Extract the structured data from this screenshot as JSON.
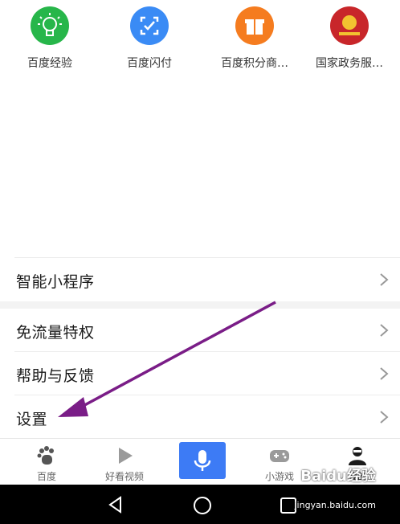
{
  "apps": [
    {
      "label": "百度经验",
      "color": "#27b64a",
      "icon": "lightbulb-icon"
    },
    {
      "label": "百度闪付",
      "color": "#3a8bf5",
      "icon": "scan-icon"
    },
    {
      "label": "百度积分商…",
      "color": "#f57c1f",
      "icon": "gift-icon"
    },
    {
      "label": "国家政务服…",
      "color": "#c8262a",
      "icon": "emblem-icon"
    }
  ],
  "menu": {
    "mini_programs": "智能小程序",
    "free_data": "免流量特权",
    "help_feedback": "帮助与反馈",
    "settings": "设置"
  },
  "tabs": {
    "baidu": "百度",
    "haokan": "好看视频",
    "mini_games": "小游戏",
    "mine": "我的"
  },
  "watermark": {
    "logo": "Baidu经验",
    "url": "jingyan.baidu.com"
  },
  "colors": {
    "accent": "#3d7bf5",
    "arrow": "#7a1d87"
  }
}
